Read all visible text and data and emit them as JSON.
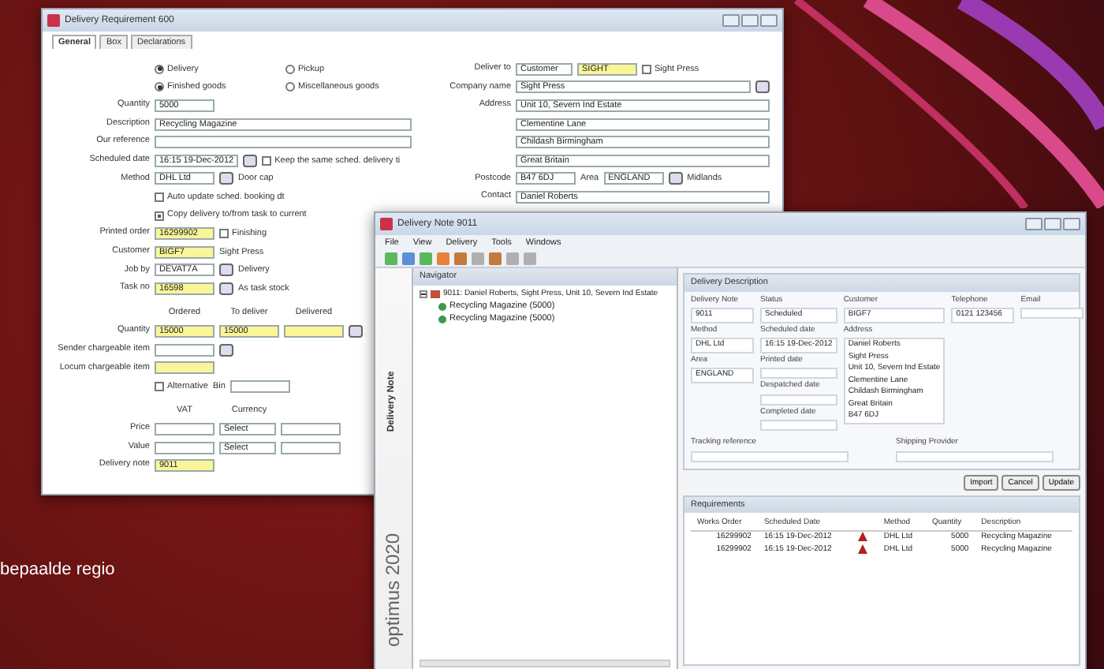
{
  "requirement_window": {
    "title": "Delivery Requirement 600",
    "tabs": [
      {
        "label": "General",
        "selected": true
      },
      {
        "label": "Box",
        "selected": false
      },
      {
        "label": "Declarations",
        "selected": false
      }
    ],
    "left_rows": [
      {
        "kind": "controls",
        "label": "",
        "items": [
          {
            "kind": "radio",
            "label": "Delivery",
            "selected": true
          },
          {
            "kind": "radio",
            "label": "Pickup",
            "selected": false
          }
        ]
      },
      {
        "kind": "controls",
        "label": "",
        "items": [
          {
            "kind": "radio",
            "label": "Finished goods",
            "selected": true
          },
          {
            "kind": "radio",
            "label": "Miscellaneous goods",
            "selected": false
          }
        ]
      },
      {
        "kind": "controls",
        "label": "Quantity",
        "items": [
          {
            "kind": "field",
            "value": "5000",
            "highlighted": false
          }
        ]
      },
      {
        "kind": "controls",
        "label": "Description",
        "items": [
          {
            "kind": "field",
            "value": "Recycling Magazine",
            "highlighted": false,
            "wide": true
          }
        ]
      },
      {
        "kind": "controls",
        "label": "Our reference",
        "items": [
          {
            "kind": "field",
            "value": "",
            "highlighted": false,
            "wide": true
          }
        ]
      },
      {
        "kind": "controls",
        "label": "Scheduled date",
        "items": [
          {
            "kind": "field",
            "value": "16:15 19-Dec-2012",
            "highlighted": false
          },
          {
            "kind": "button"
          },
          {
            "kind": "check",
            "label": "Keep the same sched. delivery ti",
            "checked": false
          }
        ]
      },
      {
        "kind": "controls",
        "label": "Method",
        "items": [
          {
            "kind": "field",
            "value": "DHL Ltd",
            "highlighted": false
          },
          {
            "kind": "button"
          },
          {
            "kind": "text",
            "text": "Door cap"
          }
        ]
      },
      {
        "kind": "controls",
        "label": "",
        "items": [
          {
            "kind": "check",
            "label": "Auto update sched. booking dt",
            "checked": false
          }
        ]
      },
      {
        "kind": "controls",
        "label": "",
        "items": [
          {
            "kind": "check",
            "label": "Copy delivery to/from task to current",
            "checked": true
          }
        ]
      },
      {
        "kind": "controls",
        "label": "Printed order",
        "items": [
          {
            "kind": "field",
            "value": "16299902",
            "highlighted": true
          },
          {
            "kind": "check",
            "label": "Finishing",
            "checked": false
          }
        ]
      },
      {
        "kind": "controls",
        "label": "Customer",
        "items": [
          {
            "kind": "field",
            "value": "BIGF7",
            "highlighted": true
          },
          {
            "kind": "text",
            "text": "Sight Press"
          }
        ]
      },
      {
        "kind": "controls",
        "label": "Job by",
        "items": [
          {
            "kind": "field",
            "value": "DEVAT7A",
            "highlighted": false
          },
          {
            "kind": "button"
          },
          {
            "kind": "text",
            "text": "Delivery"
          }
        ]
      },
      {
        "kind": "controls",
        "label": "Task no",
        "items": [
          {
            "kind": "field",
            "value": "16598",
            "highlighted": true
          },
          {
            "kind": "button"
          },
          {
            "kind": "text",
            "text": "As task stock"
          }
        ]
      },
      {
        "kind": "headers",
        "label": "",
        "items": [
          {
            "kind": "text",
            "text": "Ordered"
          },
          {
            "kind": "text",
            "text": "To deliver"
          },
          {
            "kind": "text",
            "text": "Delivered"
          }
        ]
      },
      {
        "kind": "controls",
        "label": "Quantity",
        "items": [
          {
            "kind": "field",
            "value": "15000",
            "highlighted": true
          },
          {
            "kind": "field",
            "value": "15000",
            "highlighted": true
          },
          {
            "kind": "field",
            "value": "",
            "highlighted": true
          },
          {
            "kind": "button"
          }
        ]
      },
      {
        "kind": "controls",
        "label": "Sender chargeable item",
        "items": [
          {
            "kind": "field",
            "value": "",
            "highlighted": false
          },
          {
            "kind": "button"
          }
        ]
      },
      {
        "kind": "controls",
        "label": "Locum chargeable item",
        "items": [
          {
            "kind": "field",
            "value": "",
            "highlighted": true
          }
        ]
      },
      {
        "kind": "controls",
        "label": "",
        "items": [
          {
            "kind": "check",
            "label": "Alternative",
            "checked": false
          },
          {
            "kind": "text",
            "text": "Bin"
          },
          {
            "kind": "field",
            "value": "",
            "highlighted": false
          }
        ]
      },
      {
        "kind": "headers",
        "label": "",
        "items": [
          {
            "kind": "text",
            "text": "VAT"
          },
          {
            "kind": "text",
            "text": "Currency"
          }
        ]
      },
      {
        "kind": "controls",
        "label": "Price",
        "items": [
          {
            "kind": "field",
            "value": "",
            "highlighted": false
          },
          {
            "kind": "select",
            "value": "Select"
          },
          {
            "kind": "field",
            "value": "",
            "highlighted": false
          }
        ]
      },
      {
        "kind": "controls",
        "label": "Value",
        "items": [
          {
            "kind": "field",
            "value": "",
            "highlighted": false
          },
          {
            "kind": "select",
            "value": "Select"
          },
          {
            "kind": "field",
            "value": "",
            "highlighted": false
          }
        ]
      },
      {
        "kind": "controls",
        "label": "Delivery note",
        "items": [
          {
            "kind": "field",
            "value": "9011",
            "highlighted": true
          }
        ]
      }
    ],
    "right_rows": [
      {
        "kind": "controls",
        "label": "Deliver to",
        "items": [
          {
            "kind": "select",
            "value": "Customer"
          },
          {
            "kind": "field",
            "value": "SIGHT",
            "highlighted": true
          },
          {
            "kind": "check",
            "label": "Sight Press",
            "checked": false
          }
        ]
      },
      {
        "kind": "controls",
        "label": "Company name",
        "items": [
          {
            "kind": "field",
            "value": "Sight Press",
            "highlighted": false,
            "wide": true
          },
          {
            "kind": "button"
          }
        ]
      },
      {
        "kind": "controls",
        "label": "Address",
        "items": [
          {
            "kind": "field",
            "value": "Unit 10, Severn Ind Estate",
            "highlighted": false,
            "wide": true
          }
        ]
      },
      {
        "kind": "controls",
        "label": "",
        "items": [
          {
            "kind": "field",
            "value": "Clementine Lane",
            "highlighted": false,
            "wide": true
          }
        ]
      },
      {
        "kind": "controls",
        "label": "",
        "items": [
          {
            "kind": "field",
            "value": "Childash Birmingham",
            "highlighted": false,
            "wide": true
          }
        ]
      },
      {
        "kind": "controls",
        "label": "",
        "items": [
          {
            "kind": "field",
            "value": "Great Britain",
            "highlighted": false,
            "wide": true
          }
        ]
      },
      {
        "kind": "controls",
        "label": "Postcode",
        "items": [
          {
            "kind": "field",
            "value": "B47 6DJ",
            "highlighted": false
          },
          {
            "kind": "text",
            "text": "Area"
          },
          {
            "kind": "field",
            "value": "ENGLAND",
            "highlighted": false
          },
          {
            "kind": "button"
          },
          {
            "kind": "text",
            "text": "Midlands"
          }
        ]
      },
      {
        "kind": "controls",
        "label": "Contact",
        "items": [
          {
            "kind": "field",
            "value": "Daniel Roberts",
            "highlighted": false,
            "wide": true
          }
        ]
      }
    ]
  },
  "delivery_window": {
    "title": "Delivery Note 9011",
    "menu": [
      "File",
      "View",
      "Delivery",
      "Tools",
      "Windows"
    ],
    "side_strip": {
      "title": "Delivery Note",
      "brand": "optimus 2020"
    },
    "navigator": {
      "title": "Navigator",
      "tree": [
        {
          "label": "9011: Daniel Roberts, Sight Press, Unit 10, Severn Ind Estate",
          "expanded": true,
          "children": [
            {
              "label": "Recycling Magazine (5000)"
            },
            {
              "label": "Recycling Magazine (5000)"
            }
          ]
        }
      ]
    },
    "description": {
      "title": "Delivery Description",
      "columns": [
        [
          {
            "label": "Delivery Note",
            "lines": [
              "9011"
            ]
          },
          {
            "label": "Method",
            "lines": [
              "DHL Ltd"
            ]
          },
          {
            "label": "Area",
            "lines": [
              "ENGLAND"
            ]
          }
        ],
        [
          {
            "label": "Status",
            "lines": [
              "Scheduled"
            ]
          },
          {
            "label": "Scheduled date",
            "lines": [
              "16:15 19-Dec-2012"
            ]
          },
          {
            "label": "Printed date"
          },
          {
            "label": "Despatched date"
          },
          {
            "label": "Completed date"
          }
        ],
        [
          {
            "label": "Customer",
            "lines": [
              "BIGF7"
            ]
          },
          {
            "label": "Address",
            "lines": [
              "Daniel Roberts",
              "Sight Press",
              "Unit 10, Severn Ind Estate",
              "Clementine Lane",
              "Childash Birmingham",
              "Great Britain",
              "B47 6DJ"
            ]
          }
        ],
        [
          {
            "label": "Telephone",
            "lines": [
              "0121 123456"
            ]
          }
        ],
        [
          {
            "label": "Email"
          }
        ]
      ],
      "bottom_fields": [
        {
          "label": "Tracking reference"
        },
        {
          "label": "Shipping Provider"
        }
      ],
      "buttons": [
        "Import",
        "Cancel",
        "Update"
      ]
    },
    "requirements": {
      "title": "Requirements",
      "columns": [
        "Works Order",
        "Scheduled Date",
        "Method",
        "Quantity",
        "Description"
      ],
      "rows": [
        {
          "cells": [
            "16299902",
            "16:15 19-Dec-2012",
            "DHL Ltd",
            "5000",
            "Recycling Magazine"
          ],
          "warning": true
        },
        {
          "cells": [
            "16299902",
            "16:15 19-Dec-2012",
            "DHL Ltd",
            "5000",
            "Recycling Magazine"
          ],
          "warning": true
        }
      ]
    }
  },
  "caption": "bepaalde regio"
}
